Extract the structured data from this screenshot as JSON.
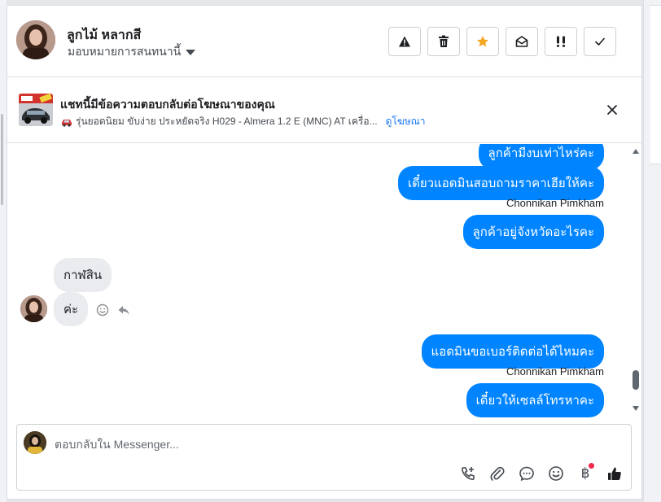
{
  "header": {
    "contact_name": "ลูกไม้ หลากสี",
    "assign_label": "มอบหมายการสนทนานี้",
    "actions": [
      "spam-warning",
      "delete",
      "star",
      "mark-unread",
      "follow-up",
      "done"
    ]
  },
  "ad": {
    "title": "แชทนี้มีข้อความตอบกลับต่อโฆษณาของคุณ",
    "subtitle": "รุ่นยอดนิยม ขับง่าย ประหยัดจริง H029 - Almera 1.2 E (MNC) AT เครื่อ...",
    "view_ad_link": "ดูโฆษณา"
  },
  "messages": [
    {
      "dir": "out",
      "text": "ลูกค้ามีงบเท่าไหร่คะ"
    },
    {
      "dir": "out",
      "text": "เดี๋ยวแอดมินสอบถามราคาเฮียให้คะ"
    },
    {
      "dir": "sender",
      "text": "Chonnikan Pimkham"
    },
    {
      "dir": "out",
      "text": "ลูกค้าอยู่จังหวัดอะไรคะ"
    },
    {
      "dir": "in",
      "text": "กาฬสิน"
    },
    {
      "dir": "in",
      "text": "ค่ะ"
    },
    {
      "dir": "out",
      "text": "แอดมินขอเบอร์ติดต่อได้ไหมคะ"
    },
    {
      "dir": "sender",
      "text": "Chonnikan Pimkham"
    },
    {
      "dir": "out",
      "text": "เดี๋ยวให้เซลล์โทรหาคะ"
    }
  ],
  "composer": {
    "placeholder": "ตอบกลับใน Messenger...",
    "baht_symbol": "฿"
  },
  "colors": {
    "brand_blue": "#0084ff",
    "link_blue": "#1877f2",
    "star": "#f5a623",
    "notification_dot": "#f02849"
  }
}
